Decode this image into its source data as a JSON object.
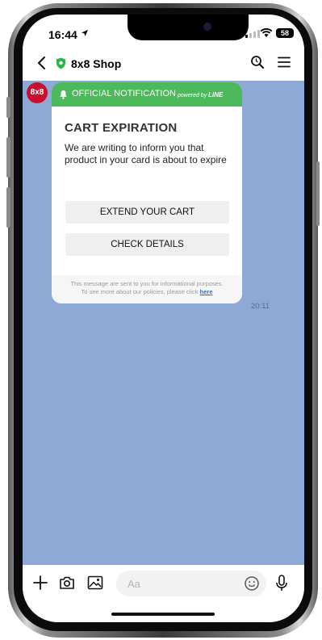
{
  "status_bar": {
    "time": "16:44",
    "battery": "58"
  },
  "header": {
    "title": "8x8 Shop"
  },
  "chat": {
    "sender_avatar": "8x8",
    "card": {
      "header_label": "OFFICIAL NOTIFICATION",
      "powered_by": "powered by",
      "powered_brand": "LINE",
      "title": "CART EXPIRATION",
      "body": "We are writing to inform you that product in your card is about to expire",
      "buttons": [
        {
          "label": "EXTEND YOUR CART"
        },
        {
          "label": "CHECK DETAILS"
        }
      ],
      "footer_line1": "This message are sent to you for informational purposes.",
      "footer_line2": "To see more about our policies, please click",
      "footer_link": "here"
    },
    "timestamp": "20:11"
  },
  "input_bar": {
    "placeholder": "Aa"
  },
  "colors": {
    "chat_bg": "#8fa9d6",
    "line_green": "#4cba5a",
    "avatar_red": "#c8102e"
  }
}
